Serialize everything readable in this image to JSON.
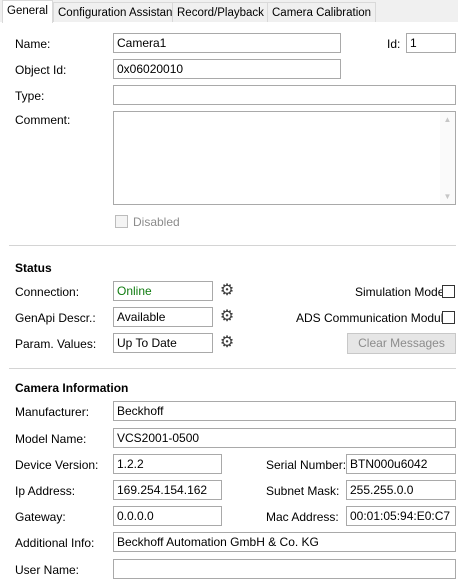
{
  "tabs": [
    {
      "label": "General",
      "active": true
    },
    {
      "label": "Configuration Assistant",
      "active": false
    },
    {
      "label": "Record/Playback",
      "active": false
    },
    {
      "label": "Camera Calibration",
      "active": false
    }
  ],
  "general": {
    "name_label": "Name:",
    "name_value": "Camera1",
    "id_label": "Id:",
    "id_value": "1",
    "object_id_label": "Object Id:",
    "object_id_value": "0x06020010",
    "type_label": "Type:",
    "type_value": "",
    "comment_label": "Comment:",
    "comment_value": "",
    "disabled_label": "Disabled"
  },
  "status": {
    "title": "Status",
    "connection_label": "Connection:",
    "connection_value": "Online",
    "genapi_label": "GenApi Descr.:",
    "genapi_value": "Available",
    "param_label": "Param. Values:",
    "param_value": "Up To Date",
    "simulation_label": "Simulation Mode",
    "ads_label": "ADS Communication Module",
    "clear_button": "Clear Messages",
    "connection_color": "#107c10"
  },
  "camera_info": {
    "title": "Camera Information",
    "manufacturer_label": "Manufacturer:",
    "manufacturer_value": "Beckhoff",
    "model_label": "Model Name:",
    "model_value": "VCS2001-0500",
    "device_version_label": "Device Version:",
    "device_version_value": "1.2.2",
    "serial_label": "Serial Number:",
    "serial_value": "BTN000u6042",
    "ip_label": "Ip Address:",
    "ip_value": "169.254.154.162",
    "subnet_label": "Subnet Mask:",
    "subnet_value": "255.255.0.0",
    "gateway_label": "Gateway:",
    "gateway_value": "0.0.0.0",
    "mac_label": "Mac Address:",
    "mac_value": "00:01:05:94:E0:C7",
    "additional_label": "Additional Info:",
    "additional_value": "Beckhoff Automation GmbH & Co. KG",
    "username_label": "User Name:",
    "username_value": ""
  },
  "icons": {
    "gear": "gear-icon",
    "scroll_up": "scroll-up-icon",
    "scroll_down": "scroll-down-icon"
  }
}
